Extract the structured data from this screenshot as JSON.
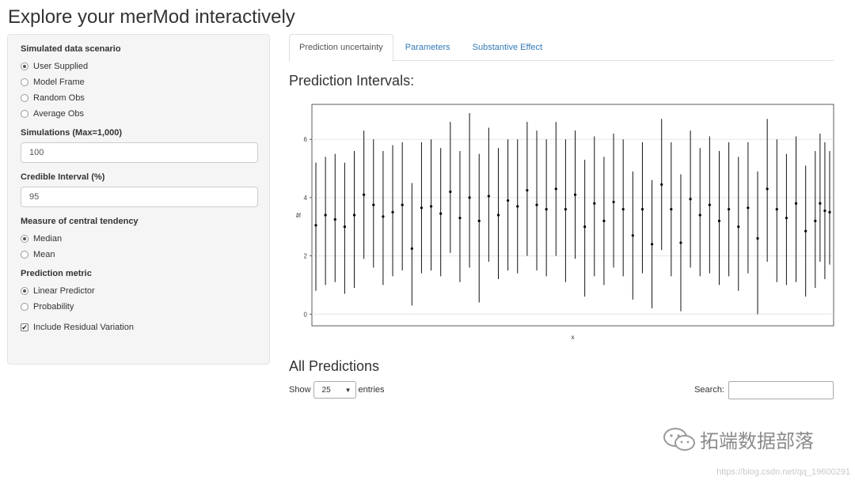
{
  "app": {
    "title": "Explore your merMod interactively"
  },
  "sidebar": {
    "scenario": {
      "label": "Simulated data scenario",
      "options": [
        "User Supplied",
        "Model Frame",
        "Random Obs",
        "Average Obs"
      ],
      "selected": 0
    },
    "simulations": {
      "label": "Simulations (Max=1,000)",
      "value": "100"
    },
    "credible": {
      "label": "Credible Interval (%)",
      "value": "95"
    },
    "tendency": {
      "label": "Measure of central tendency",
      "options": [
        "Median",
        "Mean"
      ],
      "selected": 0
    },
    "metric": {
      "label": "Prediction metric",
      "options": [
        "Linear Predictor",
        "Probability"
      ],
      "selected": 0
    },
    "residual": {
      "label": "Include Residual Variation",
      "checked": true
    }
  },
  "tabs": [
    "Prediction uncertainty",
    "Parameters",
    "Substantive Effect"
  ],
  "active_tab": 0,
  "heading": "Prediction Intervals:",
  "chart_data": {
    "type": "scatter",
    "xlabel": "x",
    "ylabel": "fit",
    "y_ticks": [
      0,
      2,
      4,
      6
    ],
    "ylim": [
      -0.4,
      7.2
    ],
    "grid": true,
    "n_points": 108,
    "points": [
      {
        "x": 1,
        "fit": 3.05,
        "lwr": 0.8,
        "upr": 5.2
      },
      {
        "x": 3,
        "fit": 3.4,
        "lwr": 1.0,
        "upr": 5.4
      },
      {
        "x": 5,
        "fit": 3.25,
        "lwr": 1.1,
        "upr": 5.5
      },
      {
        "x": 7,
        "fit": 3.0,
        "lwr": 0.7,
        "upr": 5.2
      },
      {
        "x": 9,
        "fit": 3.4,
        "lwr": 0.9,
        "upr": 5.6
      },
      {
        "x": 11,
        "fit": 4.1,
        "lwr": 1.9,
        "upr": 6.3
      },
      {
        "x": 13,
        "fit": 3.75,
        "lwr": 1.6,
        "upr": 6.0
      },
      {
        "x": 15,
        "fit": 3.35,
        "lwr": 1.0,
        "upr": 5.6
      },
      {
        "x": 17,
        "fit": 3.5,
        "lwr": 1.3,
        "upr": 5.8
      },
      {
        "x": 19,
        "fit": 3.75,
        "lwr": 1.5,
        "upr": 5.9
      },
      {
        "x": 21,
        "fit": 2.25,
        "lwr": 0.3,
        "upr": 4.5
      },
      {
        "x": 23,
        "fit": 3.65,
        "lwr": 1.4,
        "upr": 5.9
      },
      {
        "x": 25,
        "fit": 3.7,
        "lwr": 1.5,
        "upr": 6.0
      },
      {
        "x": 27,
        "fit": 3.45,
        "lwr": 1.3,
        "upr": 5.7
      },
      {
        "x": 29,
        "fit": 4.2,
        "lwr": 2.1,
        "upr": 6.6
      },
      {
        "x": 31,
        "fit": 3.3,
        "lwr": 1.1,
        "upr": 5.6
      },
      {
        "x": 33,
        "fit": 4.0,
        "lwr": 1.6,
        "upr": 6.9
      },
      {
        "x": 35,
        "fit": 3.2,
        "lwr": 0.4,
        "upr": 5.5
      },
      {
        "x": 37,
        "fit": 4.05,
        "lwr": 1.8,
        "upr": 6.4
      },
      {
        "x": 39,
        "fit": 3.4,
        "lwr": 1.2,
        "upr": 5.7
      },
      {
        "x": 41,
        "fit": 3.9,
        "lwr": 1.5,
        "upr": 6.0
      },
      {
        "x": 43,
        "fit": 3.7,
        "lwr": 1.4,
        "upr": 6.0
      },
      {
        "x": 45,
        "fit": 4.25,
        "lwr": 2.0,
        "upr": 6.6
      },
      {
        "x": 47,
        "fit": 3.75,
        "lwr": 1.5,
        "upr": 6.3
      },
      {
        "x": 49,
        "fit": 3.6,
        "lwr": 1.3,
        "upr": 6.0
      },
      {
        "x": 51,
        "fit": 4.3,
        "lwr": 2.0,
        "upr": 6.6
      },
      {
        "x": 53,
        "fit": 3.6,
        "lwr": 1.1,
        "upr": 6.0
      },
      {
        "x": 55,
        "fit": 4.1,
        "lwr": 1.9,
        "upr": 6.3
      },
      {
        "x": 57,
        "fit": 3.0,
        "lwr": 0.6,
        "upr": 5.3
      },
      {
        "x": 59,
        "fit": 3.8,
        "lwr": 1.3,
        "upr": 6.1
      },
      {
        "x": 61,
        "fit": 3.2,
        "lwr": 1.0,
        "upr": 5.4
      },
      {
        "x": 63,
        "fit": 3.85,
        "lwr": 1.6,
        "upr": 6.2
      },
      {
        "x": 65,
        "fit": 3.6,
        "lwr": 1.3,
        "upr": 6.0
      },
      {
        "x": 67,
        "fit": 2.7,
        "lwr": 0.5,
        "upr": 4.9
      },
      {
        "x": 69,
        "fit": 3.6,
        "lwr": 1.4,
        "upr": 5.9
      },
      {
        "x": 71,
        "fit": 2.4,
        "lwr": 0.2,
        "upr": 4.6
      },
      {
        "x": 73,
        "fit": 4.45,
        "lwr": 2.2,
        "upr": 6.7
      },
      {
        "x": 75,
        "fit": 3.6,
        "lwr": 1.3,
        "upr": 5.9
      },
      {
        "x": 77,
        "fit": 2.45,
        "lwr": 0.1,
        "upr": 4.8
      },
      {
        "x": 79,
        "fit": 3.95,
        "lwr": 1.6,
        "upr": 6.3
      },
      {
        "x": 81,
        "fit": 3.4,
        "lwr": 1.3,
        "upr": 5.7
      },
      {
        "x": 83,
        "fit": 3.75,
        "lwr": 1.4,
        "upr": 6.1
      },
      {
        "x": 85,
        "fit": 3.2,
        "lwr": 1.0,
        "upr": 5.6
      },
      {
        "x": 87,
        "fit": 3.6,
        "lwr": 1.3,
        "upr": 5.9
      },
      {
        "x": 89,
        "fit": 3.0,
        "lwr": 0.8,
        "upr": 5.4
      },
      {
        "x": 91,
        "fit": 3.65,
        "lwr": 1.4,
        "upr": 5.9
      },
      {
        "x": 93,
        "fit": 2.6,
        "lwr": 0.0,
        "upr": 4.9
      },
      {
        "x": 95,
        "fit": 4.3,
        "lwr": 1.8,
        "upr": 6.7
      },
      {
        "x": 97,
        "fit": 3.6,
        "lwr": 1.1,
        "upr": 6.0
      },
      {
        "x": 99,
        "fit": 3.3,
        "lwr": 1.0,
        "upr": 5.5
      },
      {
        "x": 101,
        "fit": 3.8,
        "lwr": 1.1,
        "upr": 6.1
      },
      {
        "x": 103,
        "fit": 2.85,
        "lwr": 0.6,
        "upr": 5.1
      },
      {
        "x": 105,
        "fit": 3.2,
        "lwr": 0.9,
        "upr": 5.6
      },
      {
        "x": 106,
        "fit": 3.8,
        "lwr": 1.8,
        "upr": 6.2
      },
      {
        "x": 107,
        "fit": 3.55,
        "lwr": 1.2,
        "upr": 5.9
      },
      {
        "x": 108,
        "fit": 3.5,
        "lwr": 1.7,
        "upr": 5.6
      }
    ]
  },
  "predictions": {
    "heading": "All Predictions",
    "show_label": "Show",
    "page_size": "25",
    "entries_label": "entries",
    "search_label": "Search:",
    "search_value": ""
  },
  "watermark": {
    "text": "拓端数据部落"
  },
  "footer_url": "https://blog.csdn.net/qq_19600291"
}
